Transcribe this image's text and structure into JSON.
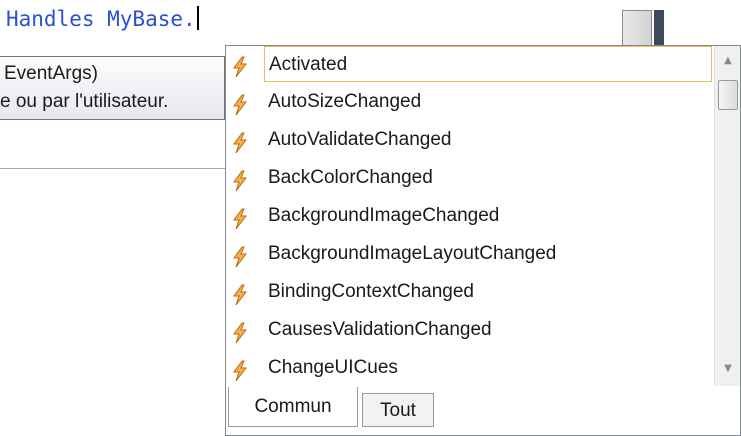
{
  "code": {
    "text": "Handles MyBase."
  },
  "tooltip": {
    "line1": "EventArgs)",
    "line2": "e ou par l'utilisateur."
  },
  "completion": {
    "items": [
      "Activated",
      "AutoSizeChanged",
      "AutoValidateChanged",
      "BackColorChanged",
      "BackgroundImageChanged",
      "BackgroundImageLayoutChanged",
      "BindingContextChanged",
      "CausesValidationChanged",
      "ChangeUICues"
    ],
    "selected_index": 0,
    "item_icon": "event-lightning-icon",
    "tabs": {
      "common": "Commun",
      "all": "Tout"
    },
    "active_tab": "Commun"
  },
  "colors": {
    "keyword": "#2b4fd6",
    "selection_border": "#e5c365",
    "icon": "#e8a33a"
  }
}
